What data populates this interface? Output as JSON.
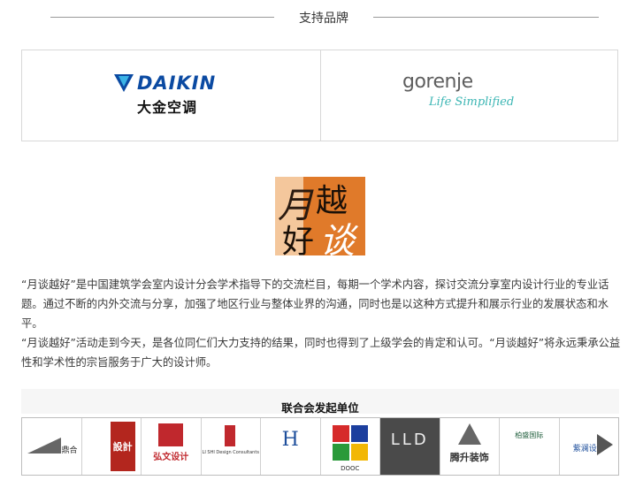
{
  "header": {
    "title": "支持品牌"
  },
  "brands": {
    "daikin": {
      "wordmark": "DAIKIN",
      "chinese": "大金空调",
      "color": "#0b4aa2"
    },
    "gorenje": {
      "wordmark": "gorenje",
      "tagline": "Life Simplified",
      "tagline_color": "#3cb6b4"
    }
  },
  "event_logo": {
    "chars": [
      "月",
      "越",
      "好",
      "谈"
    ],
    "bg_color": "#e07a2a"
  },
  "description": {
    "p1": "“月谈越好”是中国建筑学会室内设计分会学术指导下的交流栏目，每期一个学术内容，探讨交流分享室内设计行业的专业话题。通过不断的内外交流与分享，加强了地区行业与整体业界的沟通，同时也是以这种方式提升和展示行业的发展状态和水平。",
    "p2": "“月谈越好”活动走到今天，是各位同仁们大力支持的结果，同时也得到了上级学会的肯定和认可。“月谈越好”将永远秉承公益性和学术性的宗旨服务于广大的设计师。"
  },
  "sponsors": {
    "title": "联合会发起单位",
    "logos": [
      {
        "name": "鼎合",
        "text": "鼎合"
      },
      {
        "name": "藍色設計",
        "text": "藍色 設計"
      },
      {
        "name": "弘文设计",
        "text": "弘文设计"
      },
      {
        "name": "LI SHI Design Consultants",
        "text": "LI SHI Design Consultants"
      },
      {
        "name": "H",
        "text": "H"
      },
      {
        "name": "DOOC",
        "text": "DOOC"
      },
      {
        "name": "LLD",
        "text": "LLD"
      },
      {
        "name": "腾升装饰",
        "text": "腾升装饰"
      },
      {
        "name": "柏盛国际",
        "text": "柏盛国际"
      },
      {
        "name": "紫澜设计",
        "text": "紫澜设计"
      }
    ]
  }
}
